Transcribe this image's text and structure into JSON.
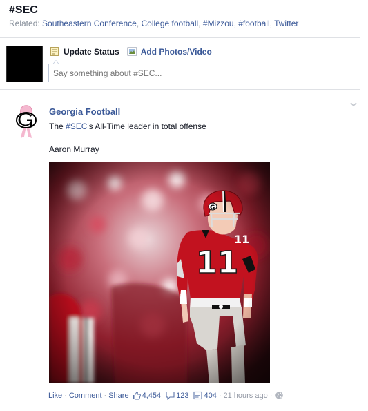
{
  "header": {
    "hashtag": "#SEC",
    "related_prefix": "Related:",
    "related_links": [
      "Southeastern Conference",
      "College football",
      "#Mizzou",
      "#football",
      "Twitter"
    ]
  },
  "composer": {
    "update_status_label": "Update Status",
    "add_photos_label": "Add Photos/Video",
    "input_placeholder": "Say something about #SEC..."
  },
  "story": {
    "author": "Georgia Football",
    "message_prefix": "The ",
    "message_hashtag": "#SEC",
    "message_suffix": "'s All-Time leader in total offense",
    "subline": "Aaron Murray",
    "photo_number": "11",
    "actions": {
      "like": "Like",
      "comment": "Comment",
      "share": "Share",
      "likes_count": "4,454",
      "comments_count": "123",
      "shares_count": "404",
      "timestamp": "21 hours ago"
    }
  },
  "icons": {
    "status": "pencil-note-icon",
    "photo": "photo-icon",
    "like": "thumbs-up-icon",
    "comment": "comment-bubble-icon",
    "share": "share-icon",
    "privacy": "globe-icon",
    "menu": "chevron-down-icon"
  },
  "colors": {
    "link": "#3b5998",
    "text": "#141823",
    "meta": "#9197a3",
    "uga_red": "#ba0c2f"
  }
}
